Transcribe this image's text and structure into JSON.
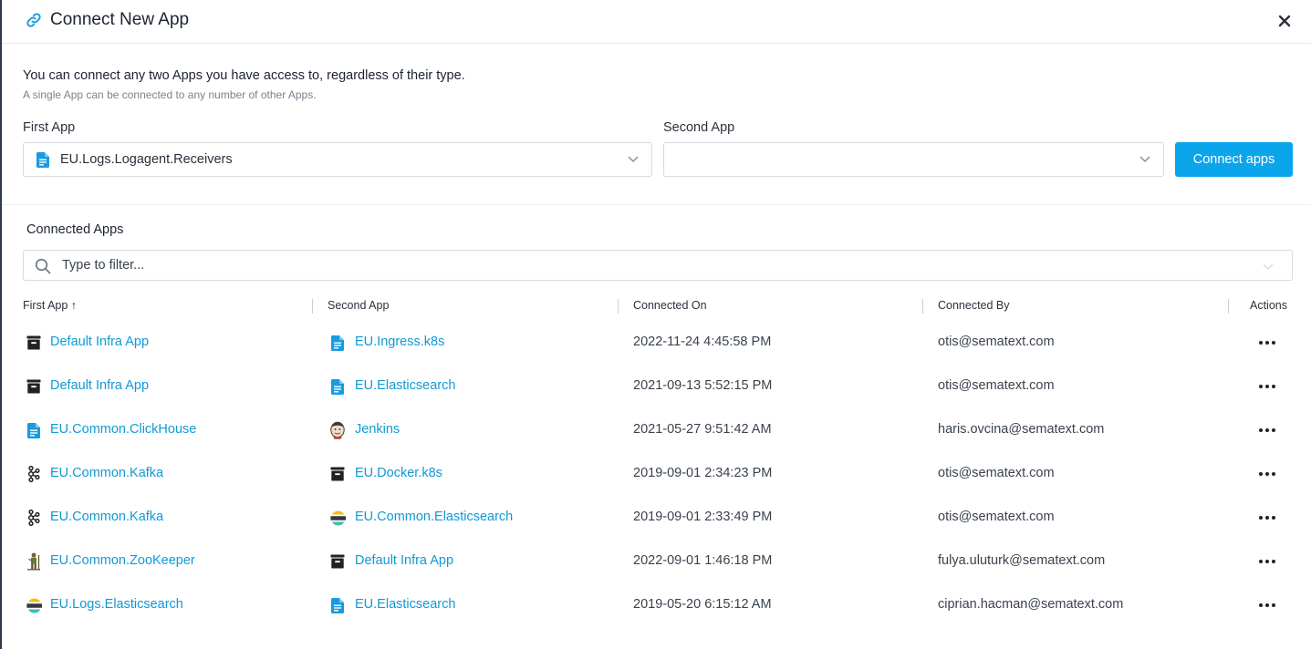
{
  "dialog": {
    "title": "Connect New App",
    "intro": "You can connect any two Apps you have access to, regardless of their type.",
    "intro_sub": "A single App can be connected to any number of other Apps."
  },
  "form": {
    "first_label": "First App",
    "first_value": "EU.Logs.Logagent.Receivers",
    "second_label": "Second App",
    "second_value": "",
    "connect_label": "Connect apps"
  },
  "connected": {
    "title": "Connected Apps",
    "filter_placeholder": "Type to filter...",
    "columns": [
      "First App ↑",
      "Second App",
      "Connected On",
      "Connected By",
      "Actions"
    ],
    "rows": [
      {
        "first": "Default Infra App",
        "first_icon": "infra-icon",
        "second": "EU.Ingress.k8s",
        "second_icon": "logs-doc-icon",
        "on": "2022-11-24 4:45:58 PM",
        "by": "otis@sematext.com"
      },
      {
        "first": "Default Infra App",
        "first_icon": "infra-icon",
        "second": "EU.Elasticsearch",
        "second_icon": "logs-doc-icon",
        "on": "2021-09-13 5:52:15 PM",
        "by": "otis@sematext.com"
      },
      {
        "first": "EU.Common.ClickHouse",
        "first_icon": "logs-doc-icon",
        "second": "Jenkins",
        "second_icon": "jenkins-icon",
        "on": "2021-05-27 9:51:42 AM",
        "by": "haris.ovcina@sematext.com"
      },
      {
        "first": "EU.Common.Kafka",
        "first_icon": "kafka-icon",
        "second": "EU.Docker.k8s",
        "second_icon": "infra-icon",
        "on": "2019-09-01 2:34:23 PM",
        "by": "otis@sematext.com"
      },
      {
        "first": "EU.Common.Kafka",
        "first_icon": "kafka-icon",
        "second": "EU.Common.Elasticsearch",
        "second_icon": "elasticsearch-icon",
        "on": "2019-09-01 2:33:49 PM",
        "by": "otis@sematext.com"
      },
      {
        "first": "EU.Common.ZooKeeper",
        "first_icon": "zookeeper-icon",
        "second": "Default Infra App",
        "second_icon": "infra-icon",
        "on": "2022-09-01 1:46:18 PM",
        "by": "fulya.uluturk@sematext.com"
      },
      {
        "first": "EU.Logs.Elasticsearch",
        "first_icon": "elasticsearch-icon",
        "second": "EU.Elasticsearch",
        "second_icon": "logs-doc-icon",
        "on": "2019-05-20 6:15:12 AM",
        "by": "ciprian.hacman@sematext.com"
      }
    ]
  },
  "colors": {
    "accent": "#0ba5ec",
    "link": "#0f9ad6",
    "icon_doc": "#1a9be0"
  }
}
